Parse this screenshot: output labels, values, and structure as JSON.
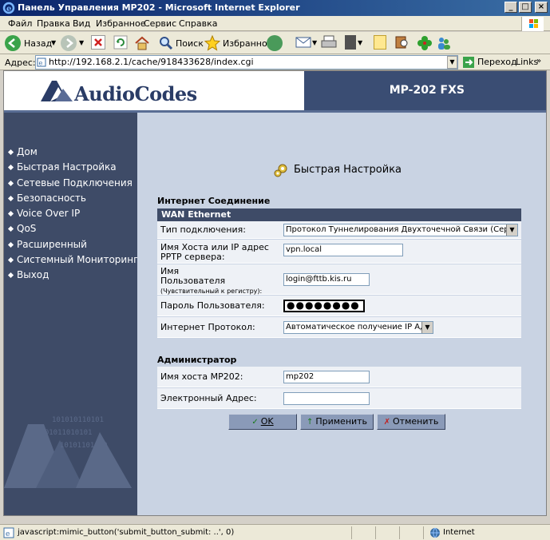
{
  "window": {
    "title": "Панель Управления MP202 - Microsoft Internet Explorer",
    "minimize": "_",
    "maximize": "□",
    "close": "×"
  },
  "menu": [
    "Файл",
    "Правка",
    "Вид",
    "Избранное",
    "Сервис",
    "Справка"
  ],
  "toolbar": {
    "back": "Назад",
    "search": "Поиск",
    "favorites": "Избранное"
  },
  "address": {
    "label": "Адрес:",
    "url": "http://192.168.2.1/cache/918433628/index.cgi",
    "go": "Переход",
    "links": "Links"
  },
  "header": {
    "logo": "AudioCodes",
    "model": "MP-202 FXS"
  },
  "sidebar": {
    "items": [
      "Дом",
      "Быстрая Настройка",
      "Сетевые Подключения",
      "Безопасность",
      "Voice Over IP",
      "QoS",
      "Расширенный",
      "Системный Мониторинг",
      "Выход"
    ]
  },
  "main": {
    "title": "Быстрая Настройка",
    "internet_section": "Интернет Соединение",
    "wan_header": "WAN Ethernet",
    "fields": {
      "conn_type_label": "Тип подключения:",
      "conn_type_value": "Протокол Туннелирования Двухточечной Связи (Сервер PPTP)",
      "host_label": "Имя Хоста или IP адрес PPTP сервера:",
      "host_value": "vpn.local",
      "user_label_1": "Имя",
      "user_label_2": "Пользователя",
      "user_label_note": "(Чувствительный к регистру):",
      "user_value": "login@fttb.kis.ru",
      "pass_label": "Пароль Пользователя:",
      "pass_value": "●●●●●●●●",
      "protocol_label": "Интернет Протокол:",
      "protocol_value": "Автоматическое получение IP Адреса"
    },
    "admin_section": "Администратор",
    "admin": {
      "hostname_label": "Имя хоста MP202:",
      "hostname_value": "mp202",
      "email_label": "Электронный Адрес:",
      "email_value": ""
    },
    "buttons": {
      "ok": "OK",
      "apply": "Применить",
      "cancel": "Отменить"
    }
  },
  "status": {
    "text": "javascript:mimic_button('submit_button_submit: ..', 0)",
    "zone": "Internet"
  },
  "colors": {
    "sidebar": "#3e4b67",
    "content_bg": "#c9d3e3",
    "titlebar": "#0a246a"
  }
}
